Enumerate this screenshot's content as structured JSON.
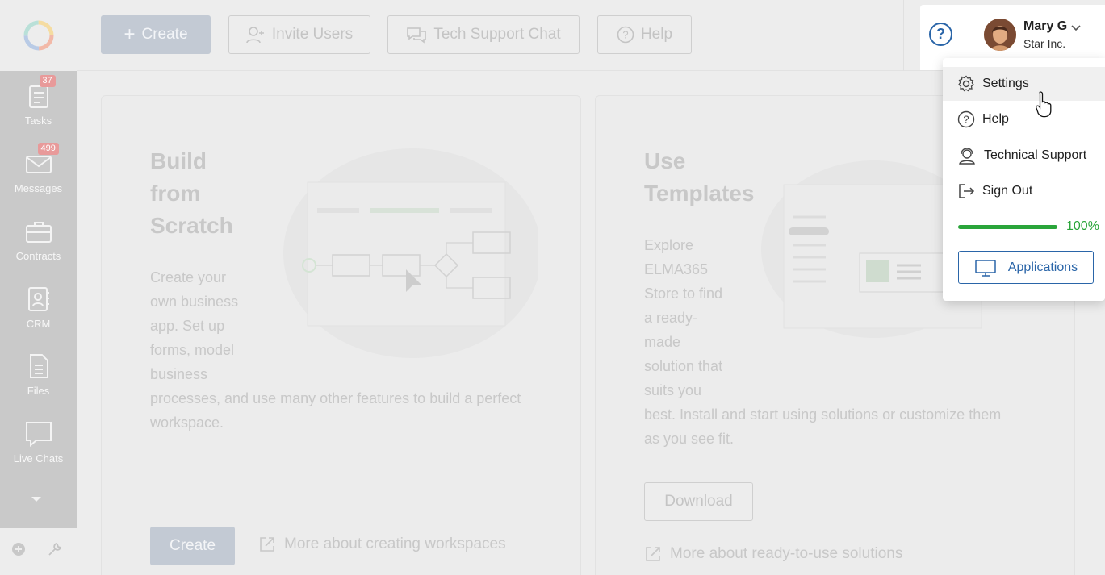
{
  "topbar": {
    "create_label": "Create",
    "invite_label": "Invite Users",
    "support_label": "Tech Support Chat",
    "help_label": "Help"
  },
  "sidebar": {
    "items": [
      {
        "label": "Tasks",
        "badge": "37",
        "icon": "tasks-icon"
      },
      {
        "label": "Messages",
        "badge": "499",
        "icon": "messages-icon"
      },
      {
        "label": "Contracts",
        "icon": "contracts-icon"
      },
      {
        "label": "CRM",
        "icon": "crm-icon"
      },
      {
        "label": "Files",
        "icon": "files-icon"
      },
      {
        "label": "Live Chats",
        "icon": "live-chats-icon"
      }
    ]
  },
  "user": {
    "name": "Mary G",
    "company": "Star Inc."
  },
  "cards": {
    "build": {
      "title_1": "Build",
      "title_2": "from",
      "title_3": "Scratch",
      "desc_lines": [
        "Create your",
        "own business",
        "app. Set up",
        "forms, model",
        "business",
        "processes, and use many other features to build a perfect",
        "workspace."
      ],
      "button": "Create",
      "link": "More about creating workspaces"
    },
    "templates": {
      "title_1": "Use",
      "title_2": "Templates",
      "desc_lines": [
        "Explore",
        "ELMA365",
        "Store to find",
        "a ready-",
        "made",
        "solution that",
        "suits you",
        "best. Install and start using solutions or customize them",
        "as you see fit."
      ],
      "button": "Download",
      "link": "More about ready-to-use solutions"
    }
  },
  "dropdown": {
    "items": [
      {
        "label": "Settings",
        "icon": "gear-icon"
      },
      {
        "label": "Help",
        "icon": "help-icon"
      },
      {
        "label": "Technical Support",
        "icon": "headset-icon"
      },
      {
        "label": "Sign Out",
        "icon": "sign-out-icon"
      }
    ],
    "progress_value": 100,
    "progress_text": "100%",
    "apps_label": "Applications"
  },
  "colors": {
    "accent": "#2a65a8",
    "progress": "#2aa53a",
    "overlay_bg": "#ededed"
  }
}
